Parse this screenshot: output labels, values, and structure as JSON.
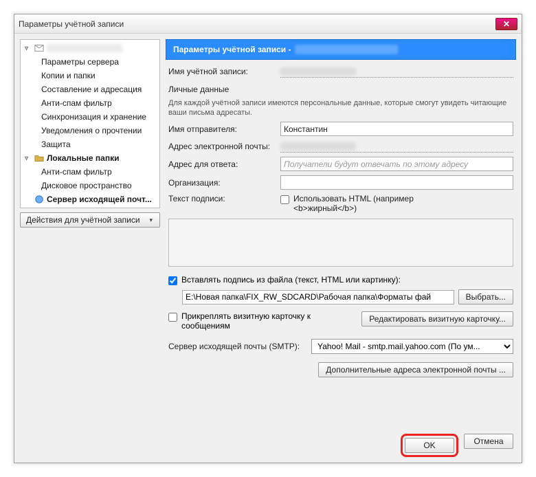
{
  "window": {
    "title": "Параметры учётной записи",
    "close_glyph": "✕"
  },
  "sidebar": {
    "account_items": [
      "Параметры сервера",
      "Копии и папки",
      "Составление и адресация",
      "Анти-спам фильтр",
      "Синхронизация и хранение",
      "Уведомления о прочтении",
      "Защита"
    ],
    "local_folders_label": "Локальные папки",
    "local_items": [
      "Анти-спам фильтр",
      "Дисковое пространство"
    ],
    "smtp_label": "Сервер исходящей почт...",
    "actions_button": "Действия для учётной записи"
  },
  "content": {
    "banner_prefix": "Параметры учётной записи -",
    "account_name_label": "Имя учётной записи:",
    "personal_data_title": "Личные данные",
    "personal_data_desc": "Для каждой учётной записи имеются персональные данные, которые смогут увидеть читающие ваши письма адресаты.",
    "sender_name_label": "Имя отправителя:",
    "sender_name_value": "Константин",
    "email_label": "Адрес электронной почты:",
    "reply_to_label": "Адрес для ответа:",
    "reply_to_placeholder": "Получатели будут отвечать по этому адресу",
    "organization_label": "Организация:",
    "signature_text_label": "Текст подписи:",
    "use_html_label": "Использовать HTML (например\n<b>жирный</b>)",
    "attach_sig_file_label": "Вставлять подпись из файла (текст, HTML или картинку):",
    "sig_file_path": "E:\\Новая папка\\FIX_RW_SDCARD\\Рабочая папка\\Форматы фай",
    "browse_button": "Выбрать...",
    "attach_vcard_label": "Прикреплять визитную карточку к сообщениям",
    "edit_vcard_button": "Редактировать визитную карточку...",
    "smtp_label": "Сервер исходящей почты (SMTP):",
    "smtp_value": "Yahoo! Mail - smtp.mail.yahoo.com (По ум...",
    "extra_emails_button": "Дополнительные адреса электронной почты ..."
  },
  "buttons": {
    "ok": "OK",
    "cancel": "Отмена"
  }
}
